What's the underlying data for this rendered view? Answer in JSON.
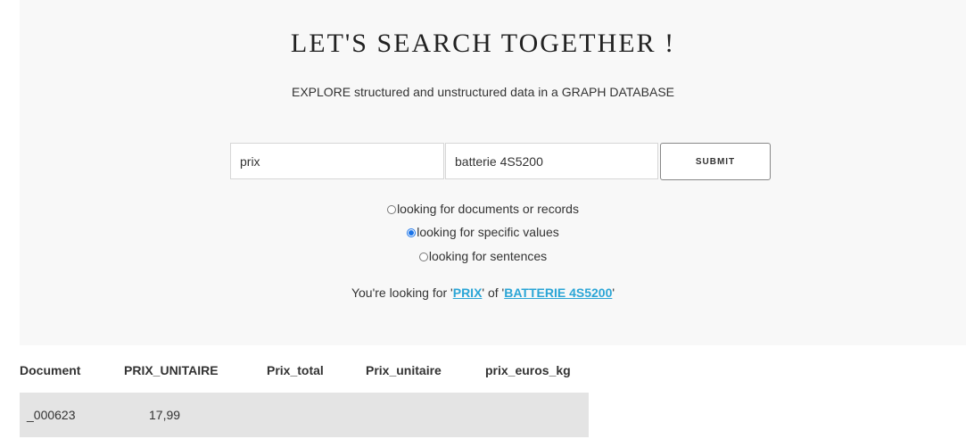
{
  "header": {
    "title": "LET'S SEARCH TOGETHER !",
    "subtitle": "EXPLORE structured and unstructured data in a GRAPH DATABASE"
  },
  "search": {
    "field1_value": "prix",
    "field2_value": "batterie 4S5200",
    "submit_label": "SUBMIT"
  },
  "options": [
    {
      "label": "looking for documents or records",
      "checked": false
    },
    {
      "label": "looking for specific values",
      "checked": true
    },
    {
      "label": "looking for sentences",
      "checked": false
    }
  ],
  "summary": {
    "prefix": "You're looking for '",
    "term1": "PRIX",
    "middle": "' of '",
    "term2": "BATTERIE 4S5200",
    "suffix": "'"
  },
  "table": {
    "columns": [
      "Document",
      "PRIX_UNITAIRE",
      "Prix_total",
      "Prix_unitaire",
      "prix_euros_kg"
    ],
    "rows": [
      [
        "_000623",
        "17,99",
        "",
        "",
        ""
      ]
    ]
  },
  "colors": {
    "link": "#2aa5d6",
    "radio_checked": "#1a73e8",
    "row_background": "#e4e4e4"
  }
}
